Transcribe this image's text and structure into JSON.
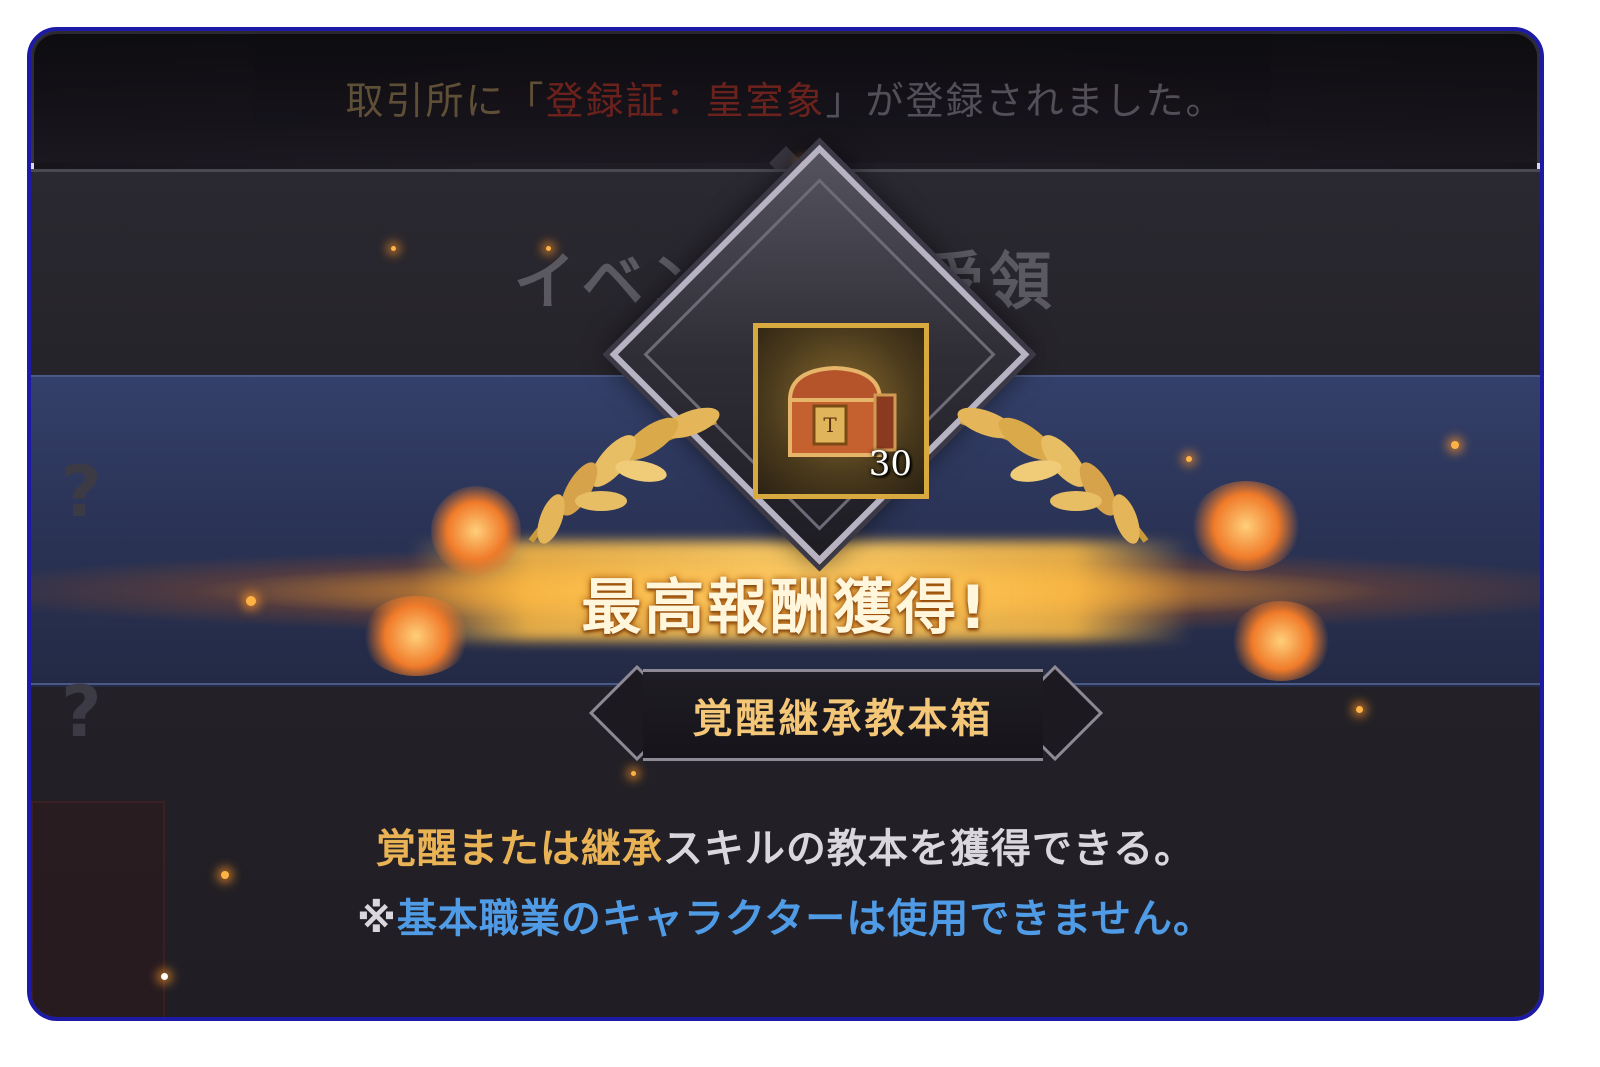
{
  "notice": {
    "prefix": "取引所に",
    "open_quote": "「",
    "item": "登録証：皇室象",
    "close_quote": "」",
    "suffix": "が登録されました。"
  },
  "panel": {
    "title": "イベント報酬受領"
  },
  "reward": {
    "quantity": "30",
    "headline": "最高報酬獲得!",
    "name": "覚醒継承教本箱",
    "description_gold": "覚醒または継承",
    "description_white": "スキルの教本を獲得できる。",
    "note_mark": "※",
    "note_text": "基本職業のキャラクターは使用できません。"
  },
  "colors": {
    "frame_border": "#1d1aa6",
    "gold": "#e9b355",
    "blue": "#4f9be6",
    "band": "#2b3457"
  },
  "icons": [
    "treasure-chest-icon",
    "laurel-left-icon",
    "laurel-right-icon",
    "spiral-ornament-icon",
    "question-mark-icon"
  ]
}
